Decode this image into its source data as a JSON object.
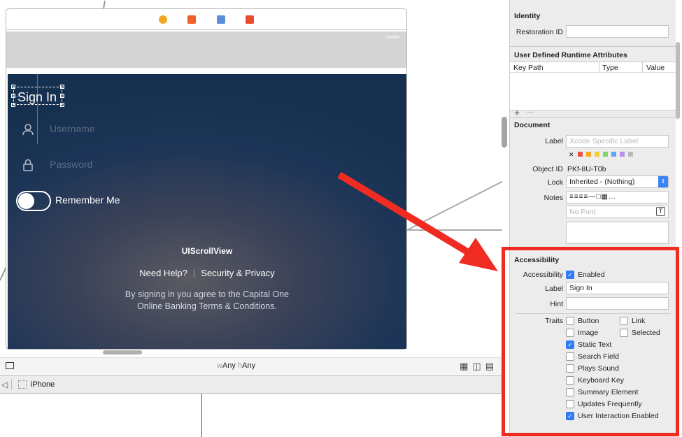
{
  "scene_dock": {
    "icons": [
      {
        "name": "view-controller-icon",
        "color": "#f5a623"
      },
      {
        "name": "first-responder-icon",
        "color": "#f0602a"
      },
      {
        "name": "exit-icon",
        "color": "#5b8fd9"
      },
      {
        "name": "storyboard-exit-icon",
        "color": "#ea4a2e"
      }
    ]
  },
  "phone": {
    "sign_in": "Sign In",
    "username_placeholder": "Username",
    "password_placeholder": "Password",
    "remember_me": "Remember Me",
    "scrollview_label": "UIScrollView",
    "need_help": "Need Help?",
    "divider": "|",
    "security_privacy": "Security & Privacy",
    "terms_line1": "By signing in you agree to the Capital One",
    "terms_line2": "Online Banking Terms & Conditions."
  },
  "bottom_bar": {
    "w_prefix": "w",
    "w_value": "Any",
    "h_prefix": "h",
    "h_value": "Any"
  },
  "jump_bar": {
    "device": "iPhone"
  },
  "inspector": {
    "identity": {
      "header": "Identity",
      "restoration_id_label": "Restoration ID",
      "restoration_id_value": ""
    },
    "runtime_attributes": {
      "header": "User Defined Runtime Attributes",
      "columns": [
        "Key Path",
        "Type",
        "Value"
      ],
      "add": "+",
      "remove": "—"
    },
    "document": {
      "header": "Document",
      "label_label": "Label",
      "label_placeholder": "Xcode Specific Label",
      "color_x": "✕",
      "label_colors": [
        "#e8534a",
        "#f5a623",
        "#f2d02a",
        "#7ed36b",
        "#5aa8f0",
        "#b88de6",
        "#b8b8b8"
      ],
      "object_id_label": "Object ID",
      "object_id_value": "PKf-8U-T0b",
      "lock_label": "Lock",
      "lock_value": "Inherited - (Nothing)",
      "notes_label": "Notes",
      "font_placeholder": "No Font"
    },
    "accessibility": {
      "header": "Accessibility",
      "accessibility_label": "Accessibility",
      "enabled_label": "Enabled",
      "enabled_checked": true,
      "label_label": "Label",
      "label_value": "Sign In",
      "hint_label": "Hint",
      "hint_value": "",
      "traits_label": "Traits",
      "traits": [
        {
          "label": "Button",
          "checked": false
        },
        {
          "label": "Link",
          "checked": false
        },
        {
          "label": "Image",
          "checked": false
        },
        {
          "label": "Selected",
          "checked": false
        },
        {
          "label": "Static Text",
          "checked": true
        },
        {
          "label": "Search Field",
          "checked": false
        },
        {
          "label": "Plays Sound",
          "checked": false
        },
        {
          "label": "Keyboard Key",
          "checked": false
        },
        {
          "label": "Summary Element",
          "checked": false
        },
        {
          "label": "Updates Frequently",
          "checked": false
        },
        {
          "label": "User Interaction Enabled",
          "checked": true
        }
      ]
    }
  },
  "annotation": {
    "arrow_color": "#f02b22",
    "frame_color": "#f02b22"
  }
}
